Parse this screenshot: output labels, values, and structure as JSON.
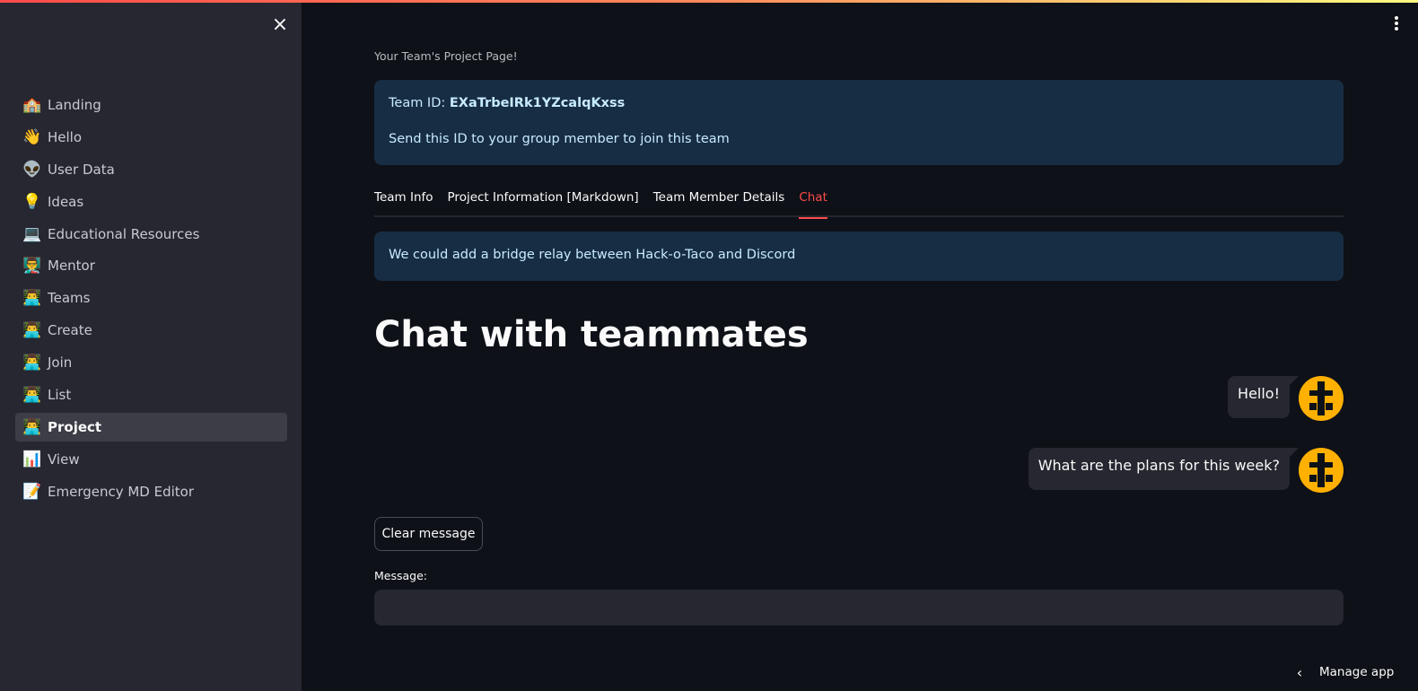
{
  "sidebar": {
    "close_icon": "×",
    "items": [
      {
        "emoji": "🏫",
        "label": "Landing"
      },
      {
        "emoji": "👋",
        "label": "Hello"
      },
      {
        "emoji": "👽",
        "label": "User Data"
      },
      {
        "emoji": "💡",
        "label": "Ideas"
      },
      {
        "emoji": "💻",
        "label": "Educational Resources"
      },
      {
        "emoji": "👨‍🏫",
        "label": "Mentor"
      },
      {
        "emoji": "👨‍💻",
        "label": "Teams"
      },
      {
        "emoji": "👨‍💻",
        "label": "Create"
      },
      {
        "emoji": "👨‍💻",
        "label": "Join"
      },
      {
        "emoji": "👨‍💻",
        "label": "List"
      },
      {
        "emoji": "👨‍💻",
        "label": "Project",
        "active": true
      },
      {
        "emoji": "📊",
        "label": "View"
      },
      {
        "emoji": "📝",
        "label": "Emergency MD Editor"
      }
    ]
  },
  "main": {
    "caption": "Your Team's Project Page!",
    "team_box": {
      "id_prefix": "Team ID: ",
      "team_id": "EXaTrbeIRk1YZcalqKxss",
      "instructions": "Send this ID to your group member to join this team"
    },
    "tabs": [
      {
        "label": "Team Info"
      },
      {
        "label": "Project Information [Markdown]"
      },
      {
        "label": "Team Member Details"
      },
      {
        "label": "Chat",
        "active": true
      }
    ],
    "idea_box": "We could add a bridge relay between Hack-o-Taco and Discord",
    "heading": "Chat with teammates",
    "messages": [
      {
        "text": "Hello!"
      },
      {
        "text": "What are the plans for this week?"
      }
    ],
    "clear_button": "Clear message",
    "message_label": "Message:",
    "message_value": ""
  },
  "footer": {
    "manage_app": "Manage app"
  },
  "colors": {
    "accent": "#ff4b4b",
    "info_bg": "#172d43",
    "sidebar_bg": "#262730",
    "avatar": "#ffb000"
  },
  "icons": {
    "close": "close-icon",
    "menu": "kebab-menu-icon",
    "avatar": "bot-avatar-icon",
    "manage_chevron": "chevron-left-icon"
  }
}
